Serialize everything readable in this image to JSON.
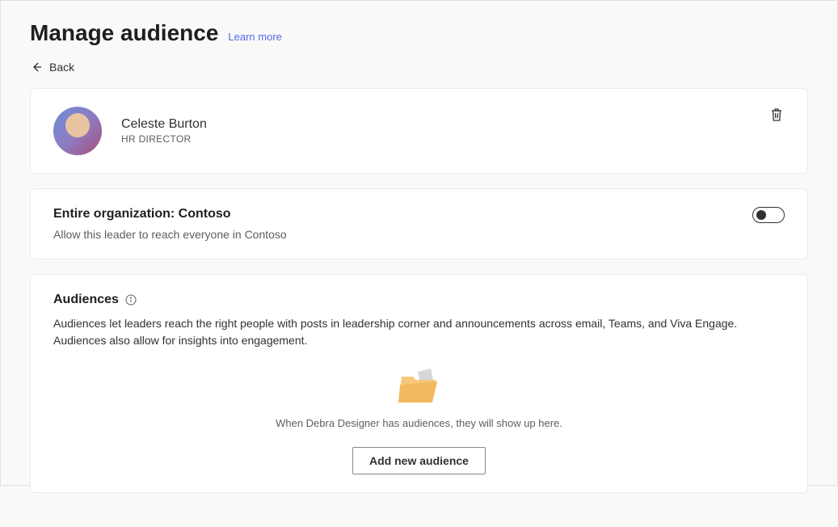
{
  "header": {
    "title": "Manage audience",
    "learn_more": "Learn more",
    "back_label": "Back"
  },
  "person": {
    "name": "Celeste Burton",
    "title": "HR DIRECTOR"
  },
  "organization": {
    "title": "Entire organization: Contoso",
    "description": "Allow this leader to reach everyone in Contoso",
    "toggle_on": false
  },
  "audiences": {
    "title": "Audiences",
    "description": "Audiences let leaders reach the right people with posts in leadership corner and announcements across email, Teams, and Viva Engage. Audiences also allow for insights into engagement.",
    "empty_text": "When Debra Designer has audiences, they will show up here.",
    "add_button_label": "Add new audience"
  }
}
